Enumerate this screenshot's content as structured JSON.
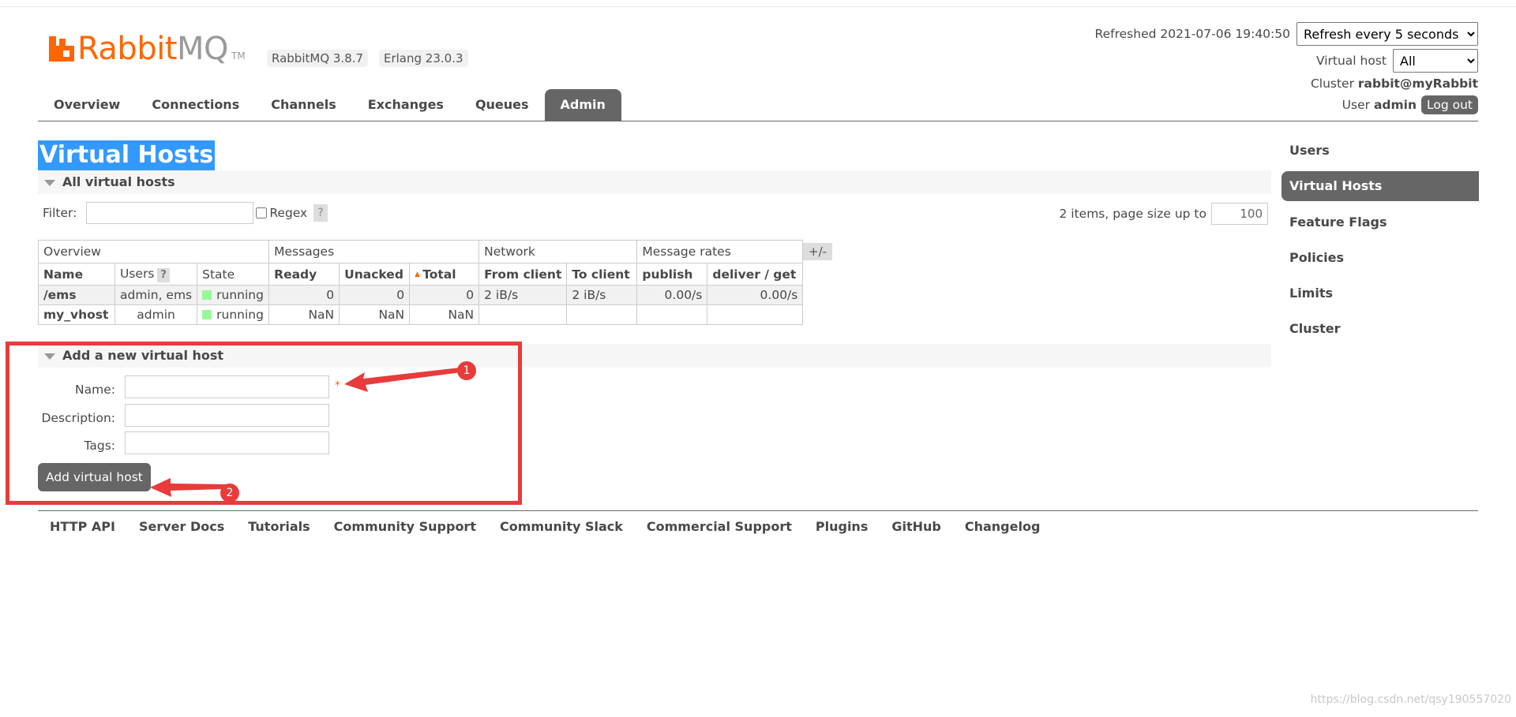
{
  "header": {
    "logo_brand": "Rabbit",
    "logo_suffix": "MQ",
    "logo_tm": "TM",
    "version": "RabbitMQ 3.8.7",
    "erlang": "Erlang 23.0.3",
    "refreshed_label": "Refreshed 2021-07-06 19:40:50",
    "refresh_select": "Refresh every 5 seconds",
    "vhost_label": "Virtual host",
    "vhost_select": "All",
    "cluster_label": "Cluster",
    "cluster_name": "rabbit@myRabbit",
    "user_label": "User",
    "user_name": "admin",
    "logout_label": "Log out"
  },
  "tabs": [
    "Overview",
    "Connections",
    "Channels",
    "Exchanges",
    "Queues",
    "Admin"
  ],
  "active_tab": "Admin",
  "page_title": "Virtual Hosts",
  "all_vhosts": {
    "section_title": "All virtual hosts",
    "filter_label": "Filter:",
    "filter_value": "",
    "regex_label": "Regex",
    "help_label": "?",
    "pager_text": "2 items, page size up to",
    "page_size": "100",
    "plus_minus": "+/-",
    "groups": [
      "Overview",
      "Messages",
      "Network",
      "Message rates"
    ],
    "columns": [
      "Name",
      "Users",
      "State",
      "Ready",
      "Unacked",
      "Total",
      "From client",
      "To client",
      "publish",
      "deliver / get"
    ],
    "rows": [
      {
        "name": "/ems",
        "users": "admin, ems",
        "state": "running",
        "ready": "0",
        "unacked": "0",
        "total": "0",
        "from_client": "2 iB/s",
        "to_client": "2 iB/s",
        "publish": "0.00/s",
        "deliver_get": "0.00/s"
      },
      {
        "name": "my_vhost",
        "users": "admin",
        "state": "running",
        "ready": "NaN",
        "unacked": "NaN",
        "total": "NaN",
        "from_client": "",
        "to_client": "",
        "publish": "",
        "deliver_get": ""
      }
    ]
  },
  "add_vhost": {
    "section_title": "Add a new virtual host",
    "name_label": "Name:",
    "required_mark": "*",
    "description_label": "Description:",
    "tags_label": "Tags:",
    "submit_label": "Add virtual host"
  },
  "annotations": {
    "badge1": "1",
    "badge2": "2",
    "color": "#e83b3b"
  },
  "sidebar": [
    "Users",
    "Virtual Hosts",
    "Feature Flags",
    "Policies",
    "Limits",
    "Cluster"
  ],
  "sidebar_active": "Virtual Hosts",
  "footer_links": [
    "HTTP API",
    "Server Docs",
    "Tutorials",
    "Community Support",
    "Community Slack",
    "Commercial Support",
    "Plugins",
    "GitHub",
    "Changelog"
  ],
  "watermark": "https://blog.csdn.net/qsy190557020",
  "colors": {
    "brand": "#ff6600",
    "nav_active": "#666666",
    "running": "#98f898",
    "highlight": "#3399ff"
  }
}
